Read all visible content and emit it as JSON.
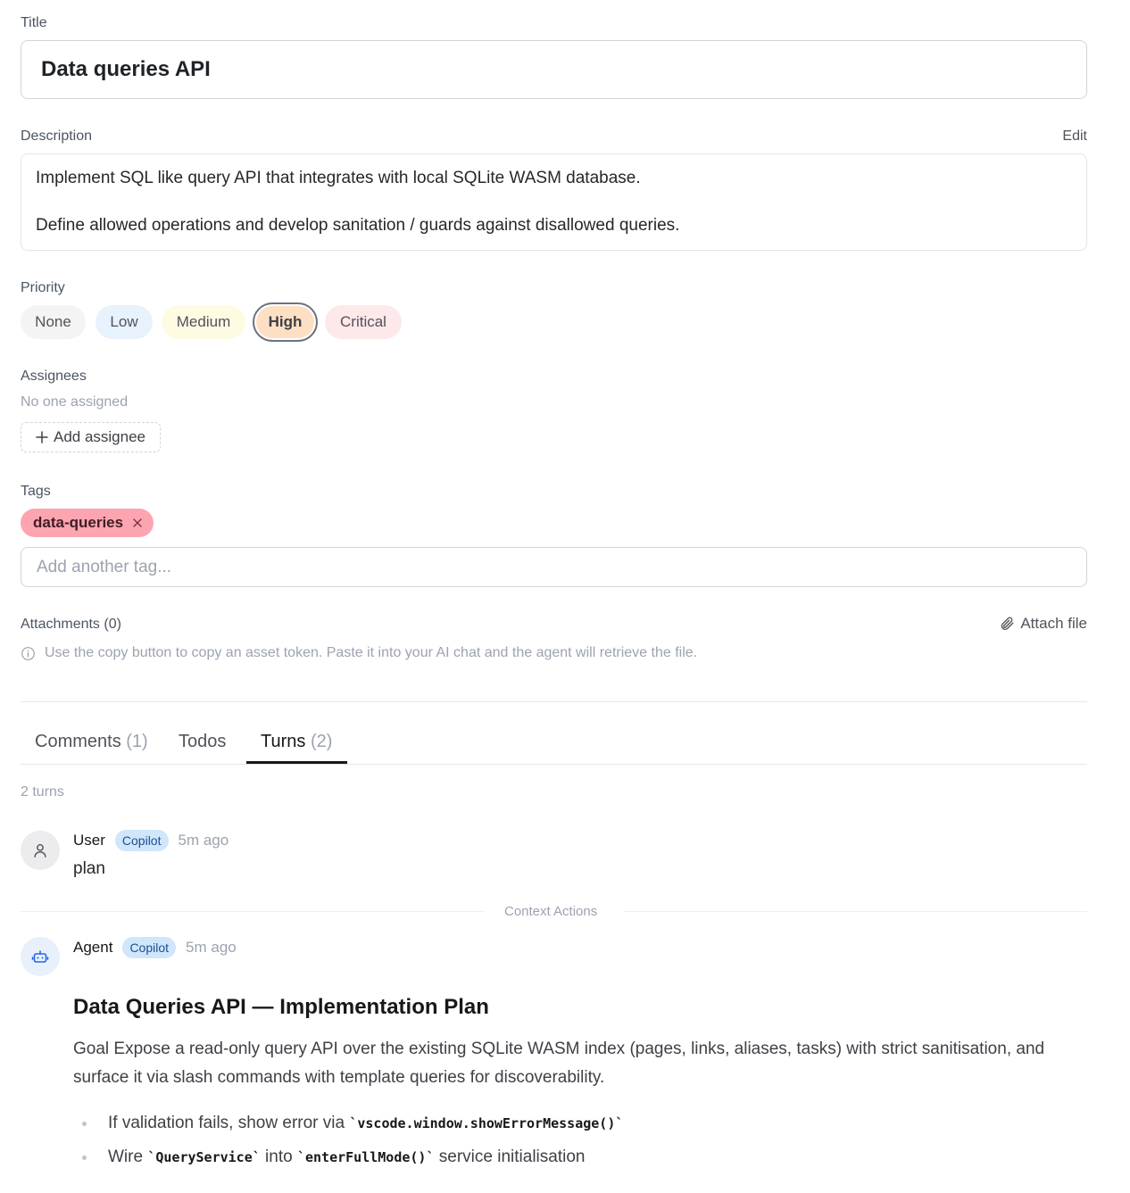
{
  "title": {
    "label": "Title",
    "value": "Data queries API"
  },
  "description": {
    "label": "Description",
    "edit_label": "Edit",
    "lines": [
      "Implement SQL like query API that integrates with local SQLite WASM database.",
      "Define allowed operations and develop sanitation / guards against disallowed queries."
    ]
  },
  "priority": {
    "label": "Priority",
    "selected": "High",
    "options": [
      {
        "label": "None",
        "color": "#f4f4f5"
      },
      {
        "label": "Low",
        "color": "#e8f2fd"
      },
      {
        "label": "Medium",
        "color": "#fefbe3"
      },
      {
        "label": "High",
        "color": "#fde0c4"
      },
      {
        "label": "Critical",
        "color": "#fde8ea"
      }
    ]
  },
  "assignees": {
    "label": "Assignees",
    "empty_text": "No one assigned",
    "add_label": "Add assignee"
  },
  "tags": {
    "label": "Tags",
    "items": [
      "data-queries"
    ],
    "input_placeholder": "Add another tag..."
  },
  "attachments": {
    "label": "Attachments (0)",
    "attach_label": "Attach file",
    "hint": "Use the copy button to copy an asset token. Paste it into your AI chat and the agent will retrieve the file."
  },
  "tabs": [
    {
      "label": "Comments",
      "count": "(1)"
    },
    {
      "label": "Todos",
      "count": ""
    },
    {
      "label": "Turns",
      "count": "(2)",
      "active": true
    }
  ],
  "turns": {
    "count_text": "2 turns",
    "items": [
      {
        "author": "User",
        "badge": "Copilot",
        "time": "5m ago",
        "text": "plan"
      },
      {
        "author": "Agent",
        "badge": "Copilot",
        "time": "5m ago"
      }
    ],
    "separator": "Context Actions"
  },
  "plan": {
    "heading": "Data Queries API — Implementation Plan",
    "paragraph": "Goal Expose a read-only query API over the existing SQLite WASM index (pages, links, aliases, tasks) with strict sanitisation, and surface it via slash commands with template queries for discoverability.",
    "bullets": [
      {
        "pre": "If validation fails, show error via ",
        "code": "`vscode.window.showErrorMessage()`",
        "mid": "",
        "code2": "",
        "post": ""
      },
      {
        "pre": "Wire ",
        "code": "`QueryService`",
        "mid": " into ",
        "code2": "`enterFullMode()`",
        "post": " service initialisation"
      }
    ]
  }
}
